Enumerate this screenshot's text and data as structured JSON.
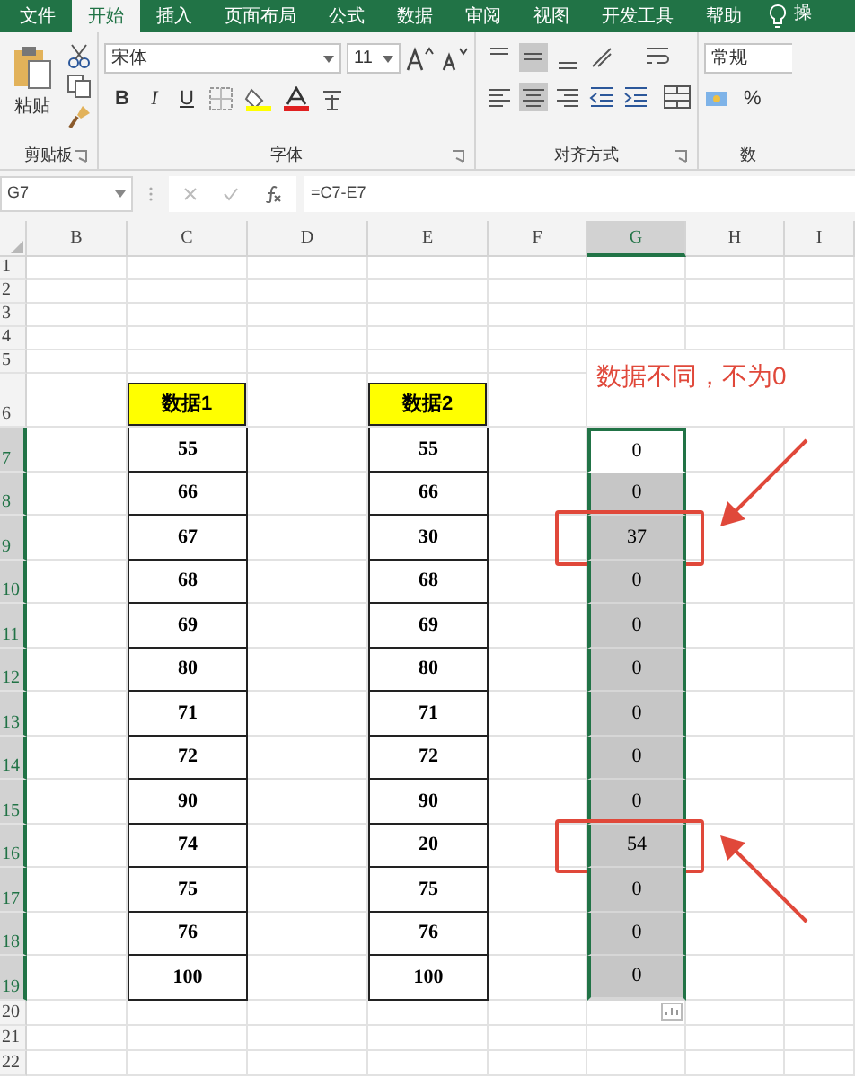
{
  "tabs": [
    {
      "label": "文件",
      "selected": false
    },
    {
      "label": "开始",
      "selected": true
    },
    {
      "label": "插入",
      "selected": false
    },
    {
      "label": "页面布局",
      "selected": false
    },
    {
      "label": "公式",
      "selected": false
    },
    {
      "label": "数据",
      "selected": false
    },
    {
      "label": "审阅",
      "selected": false
    },
    {
      "label": "视图",
      "selected": false
    },
    {
      "label": "开发工具",
      "selected": false
    },
    {
      "label": "帮助",
      "selected": false
    }
  ],
  "tell_me": "操",
  "ribbon": {
    "clipboard": {
      "paste": "粘贴",
      "label": "剪贴板"
    },
    "font": {
      "name": "宋体",
      "size": "11",
      "bold": "B",
      "italic": "I",
      "underline": "U",
      "label": "字体"
    },
    "alignment": {
      "label": "对齐方式"
    },
    "number": {
      "format": "常规",
      "percent": "%",
      "label": "数"
    }
  },
  "formula_bar": {
    "name_box": "G7",
    "formula": "=C7-E7"
  },
  "columns": [
    {
      "label": "B",
      "selected": false
    },
    {
      "label": "C",
      "selected": false
    },
    {
      "label": "D",
      "selected": false
    },
    {
      "label": "E",
      "selected": false
    },
    {
      "label": "F",
      "selected": false
    },
    {
      "label": "G",
      "selected": true
    },
    {
      "label": "H",
      "selected": false
    },
    {
      "label": "I",
      "selected": false
    }
  ],
  "top_rows": [
    "1",
    "2",
    "3",
    "4",
    "5"
  ],
  "header_row": {
    "row": "6",
    "data1": "数据1",
    "data2": "数据2"
  },
  "rows": [
    {
      "row": "7",
      "data1": "55",
      "data2": "55",
      "diff": "0",
      "active": true,
      "highlighted": false
    },
    {
      "row": "8",
      "data1": "66",
      "data2": "66",
      "diff": "0",
      "active": false,
      "highlighted": false
    },
    {
      "row": "9",
      "data1": "67",
      "data2": "30",
      "diff": "37",
      "active": false,
      "highlighted": true
    },
    {
      "row": "10",
      "data1": "68",
      "data2": "68",
      "diff": "0",
      "active": false,
      "highlighted": false
    },
    {
      "row": "11",
      "data1": "69",
      "data2": "69",
      "diff": "0",
      "active": false,
      "highlighted": false
    },
    {
      "row": "12",
      "data1": "80",
      "data2": "80",
      "diff": "0",
      "active": false,
      "highlighted": false
    },
    {
      "row": "13",
      "data1": "71",
      "data2": "71",
      "diff": "0",
      "active": false,
      "highlighted": false
    },
    {
      "row": "14",
      "data1": "72",
      "data2": "72",
      "diff": "0",
      "active": false,
      "highlighted": false
    },
    {
      "row": "15",
      "data1": "90",
      "data2": "90",
      "diff": "0",
      "active": false,
      "highlighted": false
    },
    {
      "row": "16",
      "data1": "74",
      "data2": "20",
      "diff": "54",
      "active": false,
      "highlighted": true
    },
    {
      "row": "17",
      "data1": "75",
      "data2": "75",
      "diff": "0",
      "active": false,
      "highlighted": false
    },
    {
      "row": "18",
      "data1": "76",
      "data2": "76",
      "diff": "0",
      "active": false,
      "highlighted": false
    },
    {
      "row": "19",
      "data1": "100",
      "data2": "100",
      "diff": "0",
      "active": false,
      "highlighted": false
    }
  ],
  "bottom_rows": [
    "20",
    "21",
    "22"
  ],
  "annotation": "数据不同，不为0"
}
